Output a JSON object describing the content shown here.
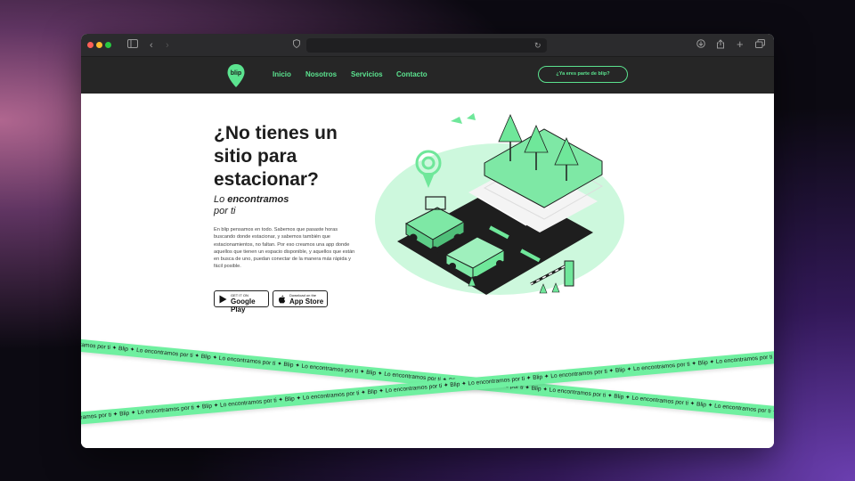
{
  "browser": {
    "url": ""
  },
  "nav": {
    "links": [
      "Inicio",
      "Nosotros",
      "Servicios",
      "Contacto"
    ],
    "cta": "¿Ya eres parte de blip?",
    "logo_text": "blip"
  },
  "hero": {
    "title": "¿No tienes un sitio para estacionar?",
    "tagline_pre": "Lo ",
    "tagline_bold": "encontramos",
    "tagline_post": "por ti",
    "paragraph": "En blip pensamos en todo. Sabemos que pasaste horas buscando donde estacionar, y sabemos también que estacionamientos, no faltan. Por eso creamos una app donde aquellos que tienen un espacio disponible, y aquellos que están en busca de uno, puedan conectar de la manera más rápida y fácil posible.",
    "google_small": "GET IT ON",
    "google_big": "Google Play",
    "apple_small": "Download on the",
    "apple_big": "App Store"
  },
  "tape": {
    "segment": "Lo encontramos por ti ✦ Blip ✦"
  },
  "colors": {
    "accent": "#5be38f",
    "tape": "#6ff0a0",
    "navbar": "#262626"
  }
}
